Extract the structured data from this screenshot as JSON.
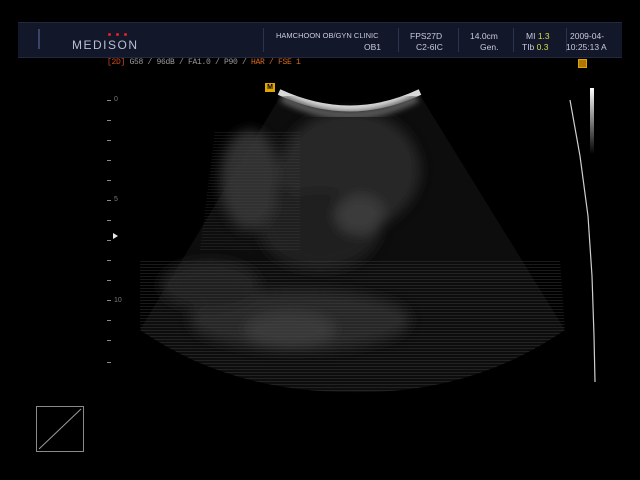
{
  "header": {
    "brand": "MEDISON",
    "clinic_name": "HAMCHOON OB/GYN CLINIC",
    "preset": "OB1",
    "fps": "FPS27D",
    "probe": "C2-6IC",
    "depth": "14.0cm",
    "mode": "Gen.",
    "mi_label": "MI",
    "mi_value": "1.3",
    "tib_label": "TIb",
    "tib_value": "0.3",
    "date": "2009-04-",
    "time": "10:25:13 A"
  },
  "mode_line": {
    "bracket": "[2D]",
    "gray_part": " G58 / 96dB / FA1.0 / P90 / ",
    "orange_part": "HAR / FSE 1"
  },
  "markers": {
    "probe_marker": "M"
  },
  "depth_scale": {
    "labels": [
      "0",
      "5",
      "10"
    ]
  },
  "colors": {
    "header_bg": "#13172a",
    "accent_value": "#d8dc4c",
    "brand_dot": "#dd2222",
    "marker": "#e0a600",
    "mode_bracket": "#d04a1c"
  },
  "icons": {
    "focus": "focus-arrow-icon",
    "probe": "probe-orientation-icon",
    "body_marker": "body-marker-icon"
  }
}
